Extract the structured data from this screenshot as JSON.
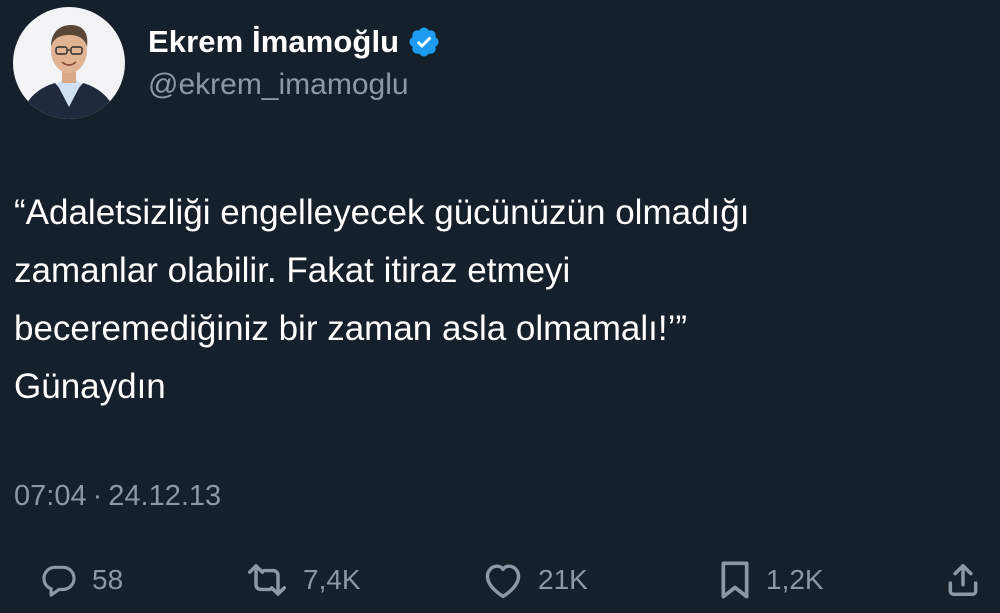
{
  "author": {
    "display_name": "Ekrem İmamoğlu",
    "handle": "@ekrem_imamoglu",
    "verified_icon": "verified-badge-icon"
  },
  "tweet": {
    "text": "“Adaletsizliği engelleyecek gücünüzün olmadığı\nzamanlar olabilir. Fakat itiraz etmeyi\nbeceremediğiniz bir zaman asla olmamalı!’”\nGünaydın",
    "time": "07:04",
    "separator": "·",
    "date": "24.12.13"
  },
  "actions": {
    "replies": "58",
    "retweets": "7,4K",
    "likes": "21K",
    "bookmarks": "1,2K"
  },
  "colors": {
    "background": "#15202b",
    "text": "#ffffff",
    "secondary": "#8b98a5",
    "verified": "#1d9bf0"
  }
}
